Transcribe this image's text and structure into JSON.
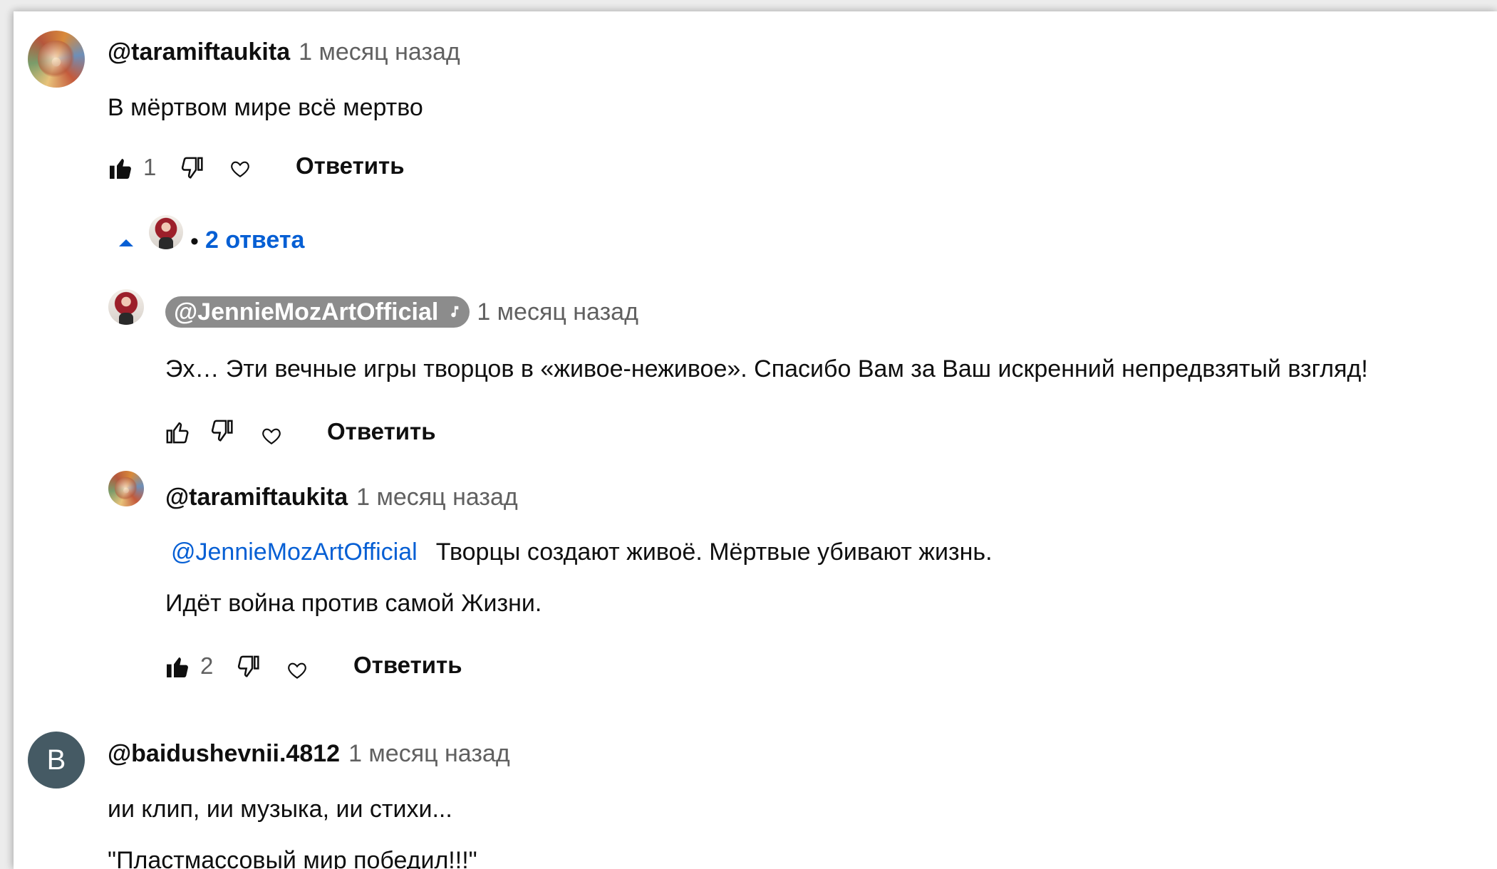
{
  "comments": [
    {
      "author": "@taramiftaukita",
      "time": "1 месяц назад",
      "text": "В мёртвом мире всё мертво",
      "likes": "1",
      "reply_label": "Ответить",
      "replies_toggle": "2 ответа",
      "replies_separator": "•",
      "replies": [
        {
          "author": "@JennieMozArtOfficial",
          "time": "1 месяц назад",
          "text": "Эх… Эти вечные игры творцов в «живое-неживое». Спасибо Вам за Ваш искренний непредвзятый взгляд!",
          "reply_label": "Ответить"
        },
        {
          "author": "@taramiftaukita",
          "time": "1 месяц назад",
          "mention": "@JennieMozArtOfficial",
          "text_line1": "Творцы создают живоё. Мёртвые убивают жизнь.",
          "text_line2": "Идёт война против самой Жизни.",
          "likes": "2",
          "reply_label": "Ответить"
        }
      ]
    },
    {
      "author": "@baidushevnii.4812",
      "time": "1 месяц назад",
      "avatar_letter": "B",
      "text_line1": "ии клип, ии музыка, ии стихи...",
      "text_line2": "\"Пластмассовый мир победил!!!\""
    }
  ],
  "colors": {
    "link": "#065fd4",
    "secondary_text": "#606060",
    "owner_badge": "#8c8c8c",
    "letter_avatar": "#455a64"
  }
}
